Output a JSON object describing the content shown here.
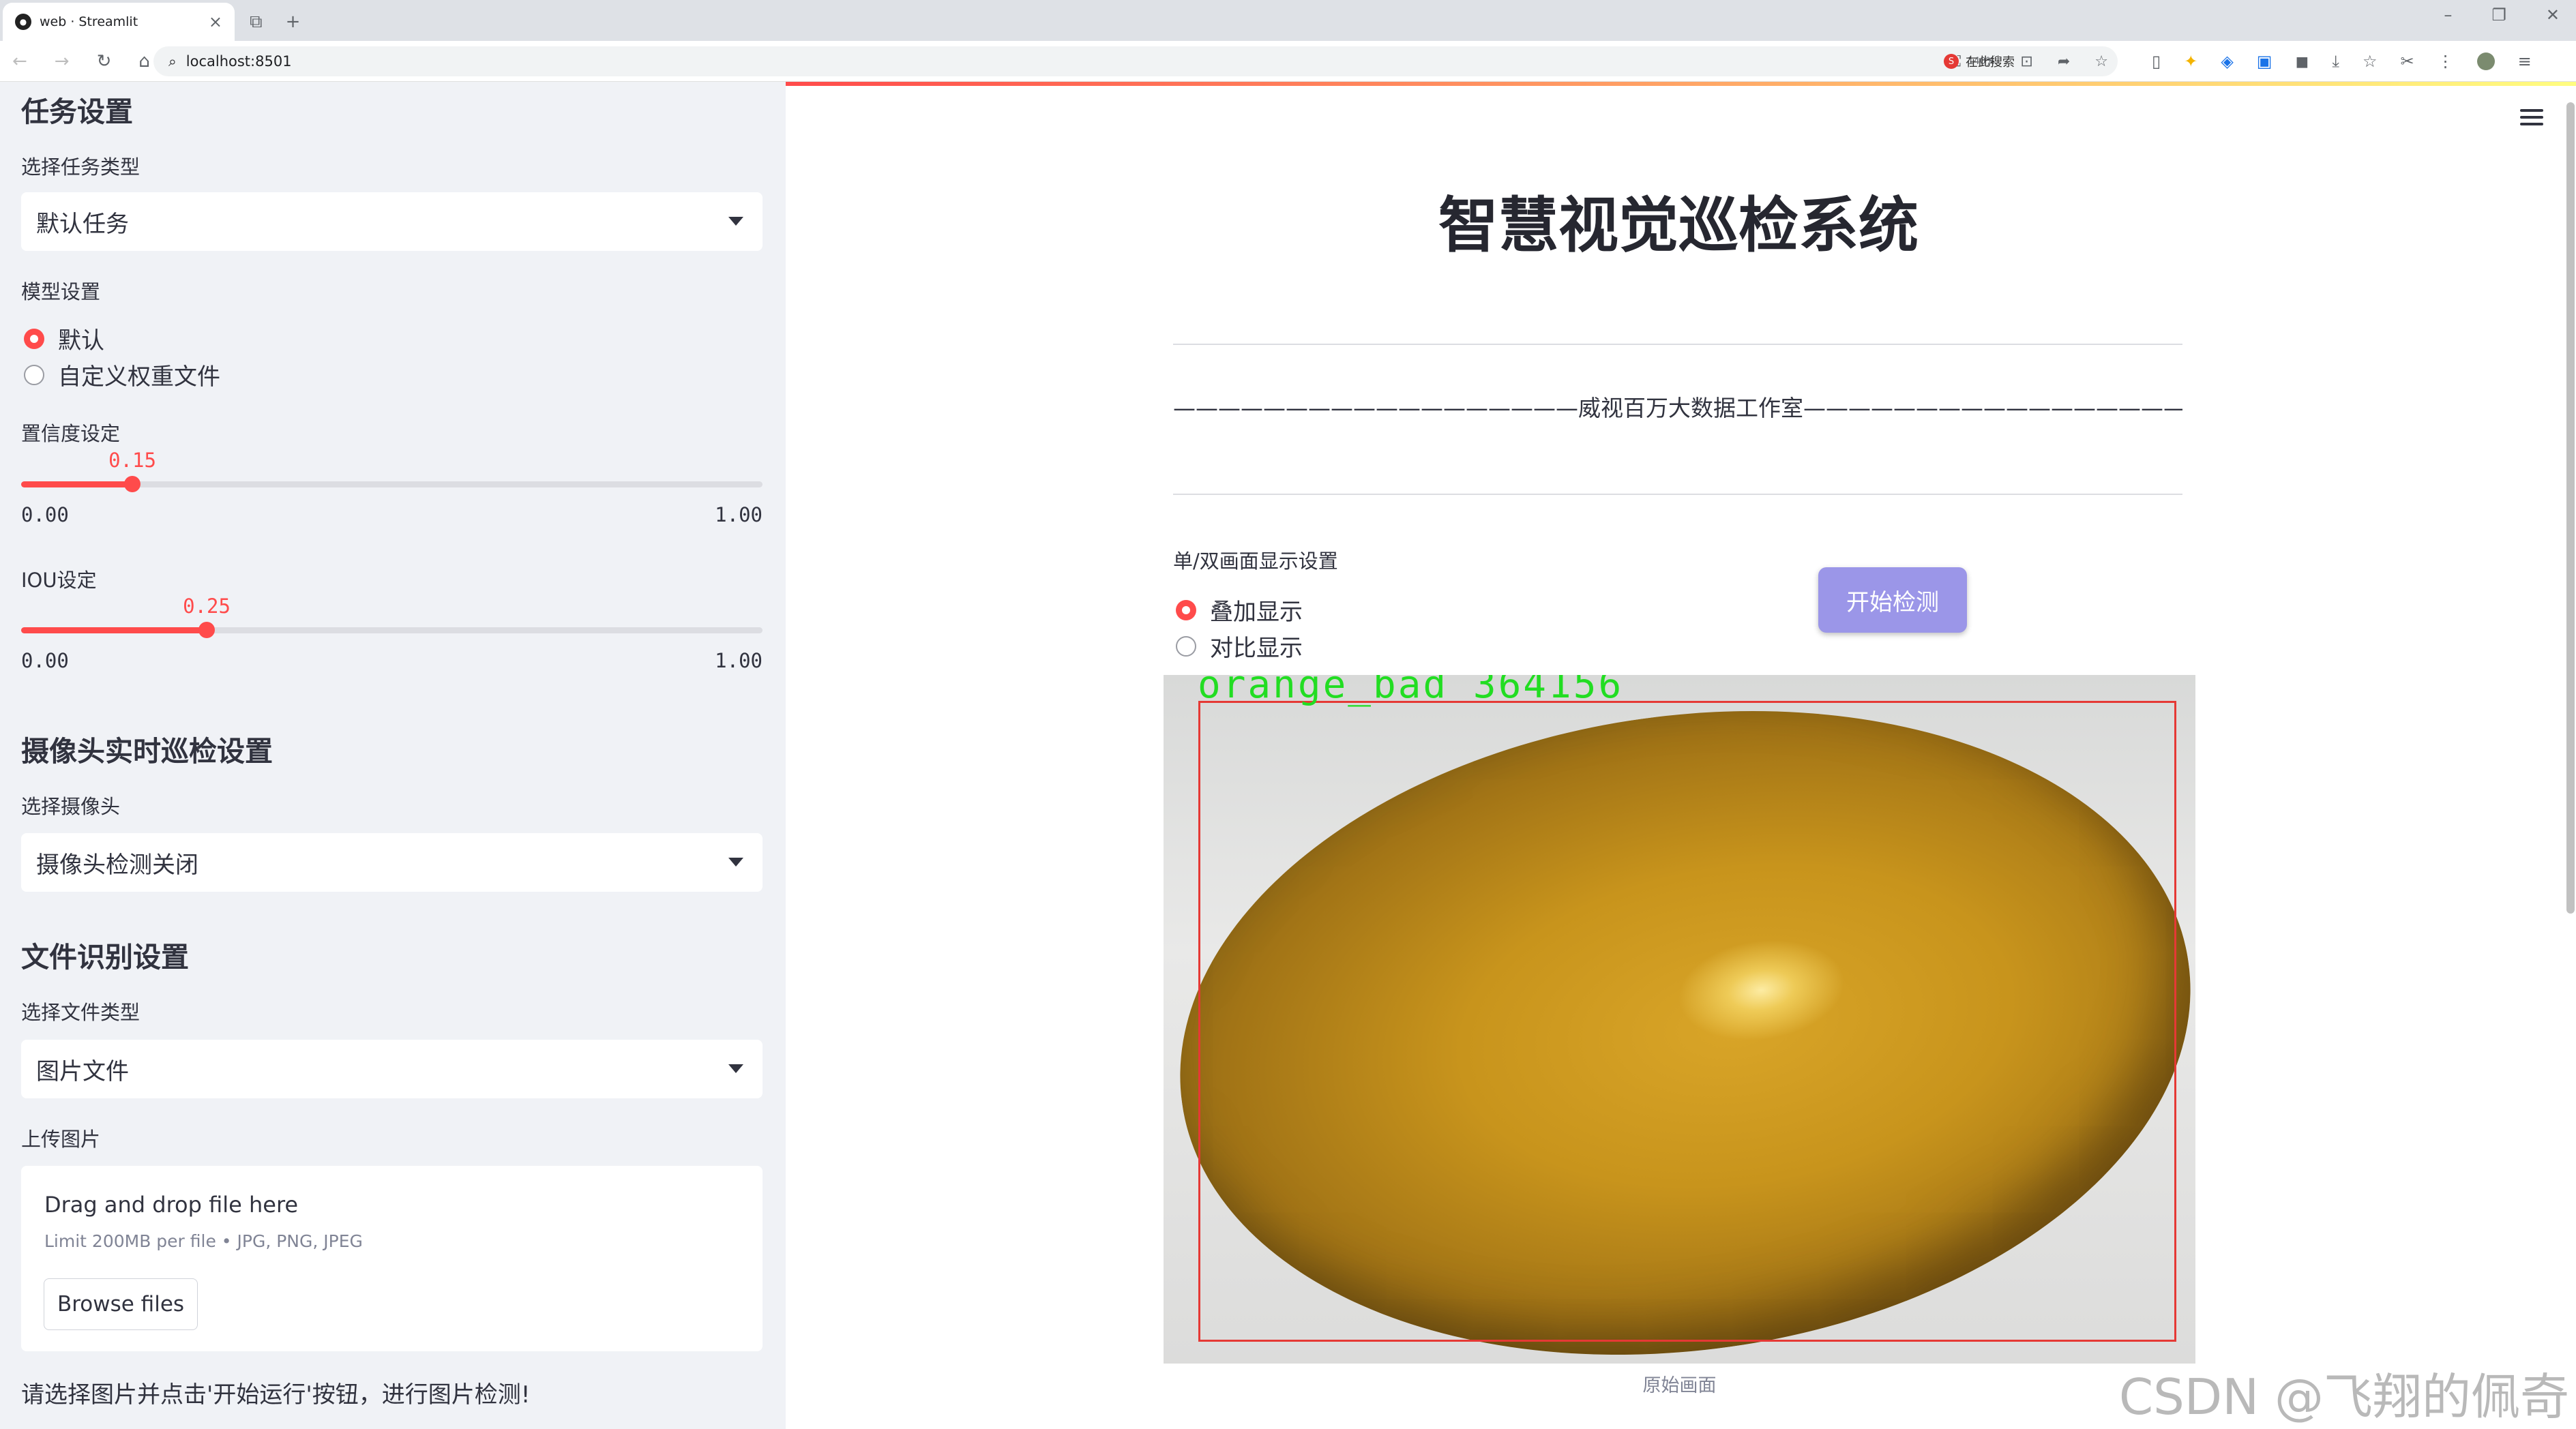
{
  "browser": {
    "tab_title": "web · Streamlit",
    "tab_close": "×",
    "new_tab": "+",
    "url": "localhost:8501",
    "zoom": "140%",
    "search_engine_label": "在此搜索",
    "window_controls": [
      "–",
      "❐",
      "✕"
    ]
  },
  "sidebar": {
    "task_heading": "任务设置",
    "task_type_label": "选择任务类型",
    "task_type_value": "默认任务",
    "model_label": "模型设置",
    "model_options": [
      "默认",
      "自定义权重文件"
    ],
    "model_selected": 0,
    "conf_label": "置信度设定",
    "conf_value": "0.15",
    "conf_fraction": 0.15,
    "iou_label": "IOU设定",
    "iou_value": "0.25",
    "iou_fraction": 0.25,
    "slider_min": "0.00",
    "slider_max": "1.00",
    "camera_heading": "摄像头实时巡检设置",
    "camera_label": "选择摄像头",
    "camera_value": "摄像头检测关闭",
    "file_heading": "文件识别设置",
    "file_type_label": "选择文件类型",
    "file_type_value": "图片文件",
    "upload_label": "上传图片",
    "upload_drag": "Drag and drop file here",
    "upload_limit": "Limit 200MB per file • JPG, PNG, JPEG",
    "browse_label": "Browse files",
    "note": "请选择图片并点击'开始运行'按钮，进行图片检测!"
  },
  "main": {
    "title": "智慧视觉巡检系统",
    "subtitle": "——————————————————威视百万大数据工作室———————————————————",
    "display_label": "单/双画面显示设置",
    "display_options": [
      "叠加显示",
      "对比显示"
    ],
    "display_selected": 0,
    "start_button": "开始检测",
    "detection_label": "orange_bad  364156",
    "image_caption": "原始画面",
    "watermark": "CSDN @飞翔的佩奇"
  },
  "colors": {
    "accent": "#ff4b4b",
    "button": "#9b96e8",
    "sidebar_bg": "#f0f2f6",
    "detection_text": "#22dd22",
    "detection_box": "#e53935"
  }
}
